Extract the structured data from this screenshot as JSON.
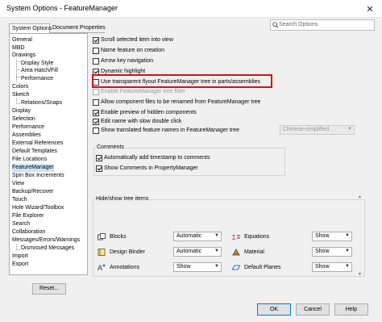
{
  "window": {
    "title": "System Options - FeatureManager",
    "close_glyph": "✕"
  },
  "tabs": [
    {
      "label": "System Options"
    },
    {
      "label": "Document Properties"
    }
  ],
  "search": {
    "placeholder": "Search Options"
  },
  "tree": {
    "items": [
      {
        "label": "General"
      },
      {
        "label": "MBD"
      },
      {
        "label": "Drawings"
      },
      {
        "label": "Display Style"
      },
      {
        "label": "Area Hatch/Fill"
      },
      {
        "label": "Performance"
      },
      {
        "label": "Colors"
      },
      {
        "label": "Sketch"
      },
      {
        "label": "Relations/Snaps"
      },
      {
        "label": "Display"
      },
      {
        "label": "Selection"
      },
      {
        "label": "Performance"
      },
      {
        "label": "Assemblies"
      },
      {
        "label": "External References"
      },
      {
        "label": "Default Templates"
      },
      {
        "label": "File Locations"
      },
      {
        "label": "FeatureManager"
      },
      {
        "label": "Spin Box Increments"
      },
      {
        "label": "View"
      },
      {
        "label": "Backup/Recover"
      },
      {
        "label": "Touch"
      },
      {
        "label": "Hole Wizard/Toolbox"
      },
      {
        "label": "File Explorer"
      },
      {
        "label": "Search"
      },
      {
        "label": "Collaboration"
      },
      {
        "label": "Messages/Errors/Warnings"
      },
      {
        "label": "Dismissed Messages"
      },
      {
        "label": "Import"
      },
      {
        "label": "Export"
      }
    ],
    "reset_label": "Reset..."
  },
  "options": [
    {
      "label": "Scroll selected item into view",
      "checked": true,
      "disabled": false
    },
    {
      "label": "Name feature on creation",
      "checked": false,
      "disabled": false
    },
    {
      "label": "Arrow key navigation",
      "checked": false,
      "disabled": false
    },
    {
      "label": "Dynamic highlight",
      "checked": true,
      "disabled": false
    },
    {
      "label": "Use transparent flyout FeatureManager tree in parts/assemblies",
      "checked": false,
      "disabled": false
    },
    {
      "label": "Enable FeatureManager tree filter",
      "checked": false,
      "disabled": true
    },
    {
      "label": "Allow component files to be renamed from FeatureManager tree",
      "checked": false,
      "disabled": false
    },
    {
      "label": "Enable preview of hidden components",
      "checked": true,
      "disabled": false
    },
    {
      "label": "Edit name with slow double click",
      "checked": true,
      "disabled": false
    },
    {
      "label": "Show translated feature names in FeatureManager tree",
      "checked": false,
      "disabled": false
    }
  ],
  "language_combo": {
    "value": "Chinese-simplified"
  },
  "comments": {
    "label": "Comments",
    "items": [
      {
        "label": "Automatically add timestamp to comments",
        "checked": true
      },
      {
        "label": "Show Comments in PropertyManager",
        "checked": true
      }
    ]
  },
  "hide_show": {
    "label": "Hide/show tree items",
    "left": [
      {
        "label": "Blocks",
        "value": "Automatic",
        "icon": "blocks-icon"
      },
      {
        "label": "Design Binder",
        "value": "Automatic",
        "icon": "design-binder-icon"
      },
      {
        "label": "Annotations",
        "value": "Show",
        "icon": "annotations-icon"
      }
    ],
    "right": [
      {
        "label": "Equations",
        "value": "Show",
        "icon": "equations-icon"
      },
      {
        "label": "Material",
        "value": "Show",
        "icon": "material-icon"
      },
      {
        "label": "Default Planes",
        "value": "Show",
        "icon": "default-planes-icon"
      }
    ]
  },
  "buttons": {
    "ok": "OK",
    "cancel": "Cancel",
    "help": "Help"
  },
  "colors": {
    "highlight": "#d0121b",
    "selection": "#cce4f7"
  }
}
